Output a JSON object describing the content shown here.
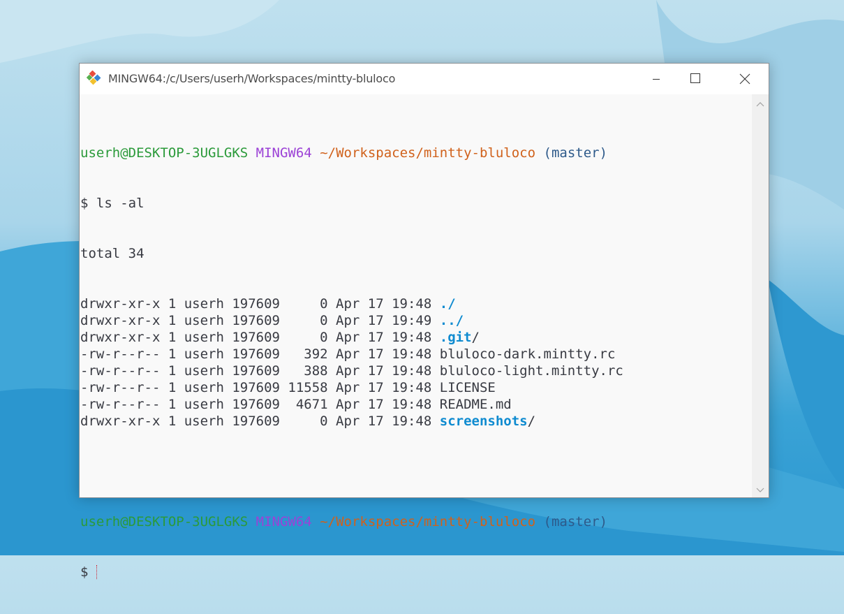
{
  "window": {
    "title": "MINGW64:/c/Users/userh/Workspaces/mintty-bluloco",
    "icon": "git-bash-icon",
    "controls": [
      "minimize-icon",
      "maximize-icon",
      "close-icon"
    ]
  },
  "colors": {
    "user": "#2b9a3a",
    "system": "#9c42d6",
    "path": "#d0611b",
    "branch": "#2e5a8a",
    "directory": "#0f8bd0",
    "text": "#383a42",
    "cursor": "#d02030"
  },
  "terminal": {
    "prompt1": {
      "user_host": "userh@DESKTOP-3UGLGKS",
      "system": "MINGW64",
      "path": "~/Workspaces/mintty-bluloco",
      "branch": "(master)"
    },
    "command": "$ ls -al",
    "total": "total 34",
    "entries": [
      {
        "meta": "drwxr-xr-x 1 userh 197609     0 Apr 17 19:48 ",
        "name": "./",
        "dir": true
      },
      {
        "meta": "drwxr-xr-x 1 userh 197609     0 Apr 17 19:49 ",
        "name": "../",
        "dir": true
      },
      {
        "meta": "drwxr-xr-x 1 userh 197609     0 Apr 17 19:48 ",
        "name": ".git",
        "suffix": "/",
        "dir": true
      },
      {
        "meta": "-rw-r--r-- 1 userh 197609   392 Apr 17 19:48 ",
        "name": "bluloco-dark.mintty.rc",
        "dir": false
      },
      {
        "meta": "-rw-r--r-- 1 userh 197609   388 Apr 17 19:48 ",
        "name": "bluloco-light.mintty.rc",
        "dir": false
      },
      {
        "meta": "-rw-r--r-- 1 userh 197609 11558 Apr 17 19:48 ",
        "name": "LICENSE",
        "dir": false
      },
      {
        "meta": "-rw-r--r-- 1 userh 197609  4671 Apr 17 19:48 ",
        "name": "README.md",
        "dir": false
      },
      {
        "meta": "drwxr-xr-x 1 userh 197609     0 Apr 17 19:48 ",
        "name": "screenshots",
        "suffix": "/",
        "dir": true
      }
    ],
    "prompt2": {
      "user_host": "userh@DESKTOP-3UGLGKS",
      "system": "MINGW64",
      "path": "~/Workspaces/mintty-bluloco",
      "branch": "(master)"
    },
    "input_prompt": "$"
  },
  "scrollbar": {
    "up_icon": "chevron-up-icon",
    "down_icon": "chevron-down-icon"
  }
}
